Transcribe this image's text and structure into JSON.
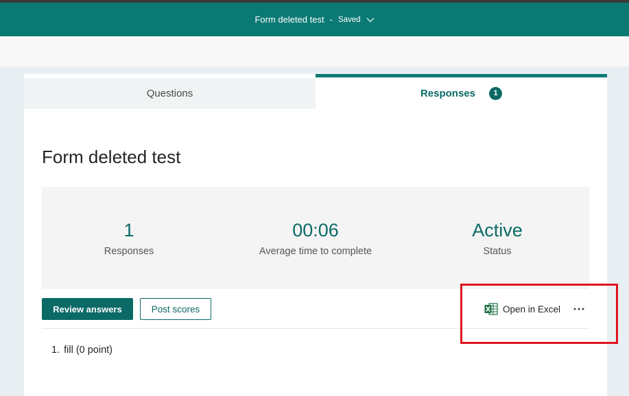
{
  "header": {
    "form_title": "Form deleted test",
    "separator": "-",
    "save_status": "Saved",
    "accent_color": "#0b7a75"
  },
  "tabs": {
    "questions_label": "Questions",
    "responses_label": "Responses",
    "responses_count": "1",
    "active": "Responses"
  },
  "main": {
    "title": "Form deleted test",
    "stats": {
      "responses_value": "1",
      "responses_label": "Responses",
      "avg_time_value": "00:06",
      "avg_time_label": "Average time to complete",
      "status_value": "Active",
      "status_label": "Status"
    },
    "actions": {
      "review_label": "Review answers",
      "post_scores_label": "Post scores",
      "open_excel_label": "Open in Excel",
      "more_icon": "more-horizontal-icon",
      "excel_icon": "excel-icon"
    },
    "questions": [
      {
        "number": "1.",
        "text": "fill (0 point)"
      }
    ]
  },
  "annotation": {
    "highlight_color": "#e0141f"
  }
}
